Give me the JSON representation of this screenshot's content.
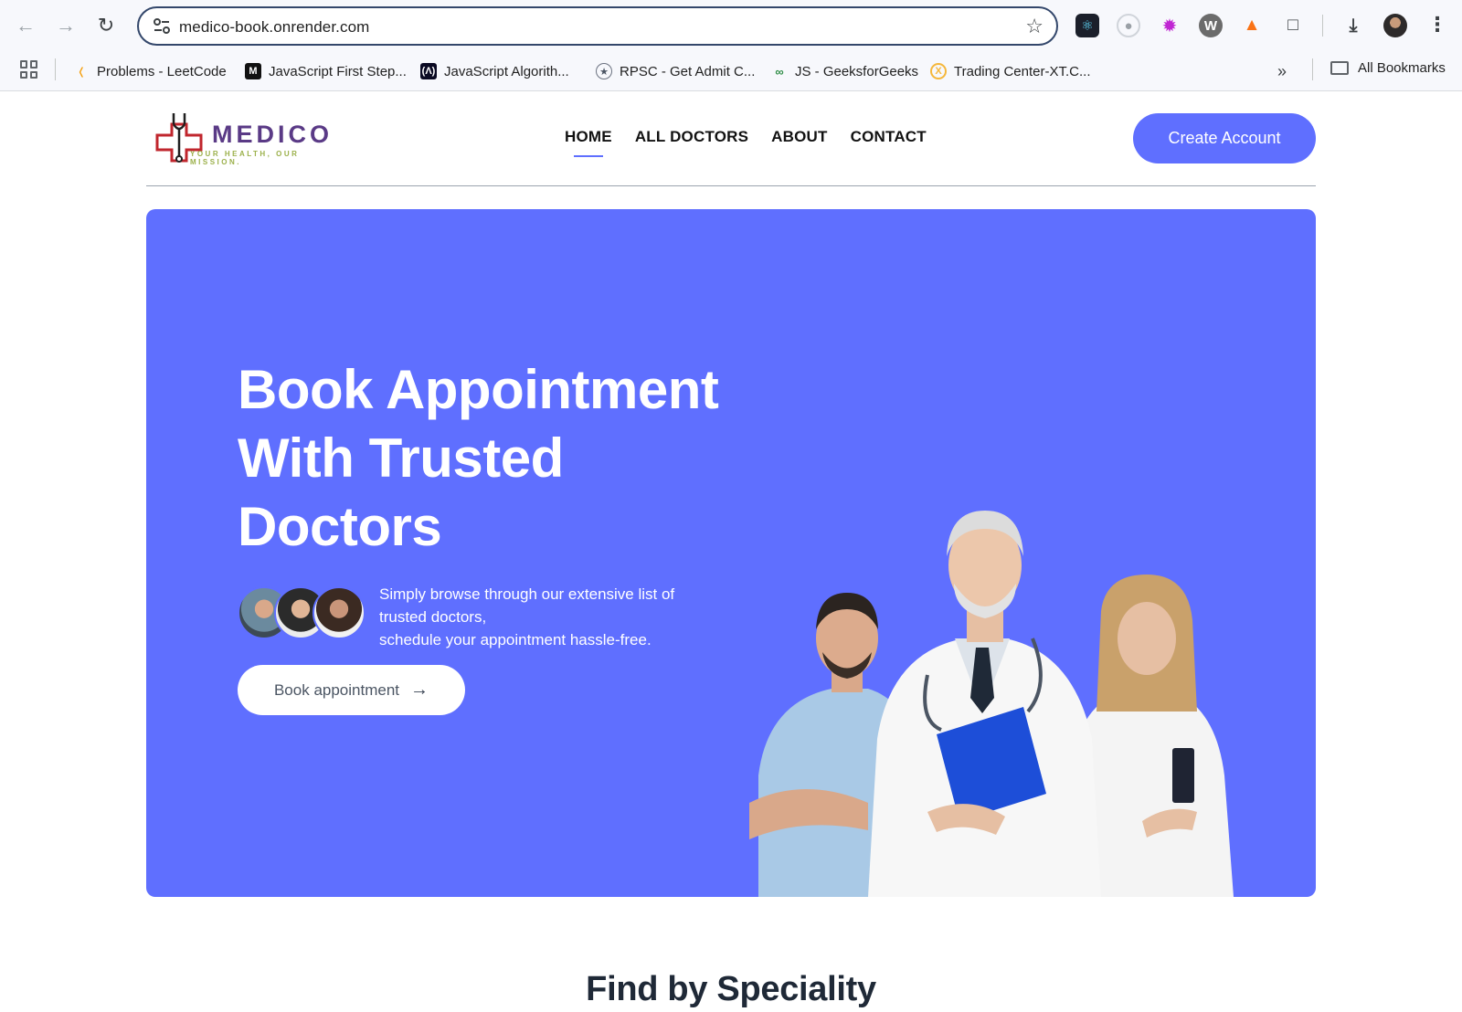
{
  "browser": {
    "url": "medico-book.onrender.com",
    "bookmarks": [
      {
        "label": "Problems - LeetCode",
        "icon": "leetcode-icon"
      },
      {
        "label": "JavaScript First Step...",
        "icon": "mdn-icon"
      },
      {
        "label": "JavaScript Algorith...",
        "icon": "freecodecamp-icon"
      },
      {
        "label": "RPSC - Get Admit C...",
        "icon": "rpsc-icon"
      },
      {
        "label": "JS - GeeksforGeeks",
        "icon": "geeksforgeeks-icon"
      },
      {
        "label": "Trading Center-XT.C...",
        "icon": "xt-icon"
      }
    ],
    "all_bookmarks_label": "All Bookmarks",
    "extensions": [
      "react-devtools-icon",
      "eye-dropper-icon",
      "colorful-swirl-icon",
      "wordpress-icon",
      "fox-extension-icon",
      "puzzle-extensions-icon"
    ]
  },
  "site": {
    "logo_word": "MEDICO",
    "logo_tagline": "YOUR HEALTH, OUR MISSION.",
    "nav": [
      {
        "label": "HOME",
        "active": true
      },
      {
        "label": "ALL DOCTORS",
        "active": false
      },
      {
        "label": "ABOUT",
        "active": false
      },
      {
        "label": "CONTACT",
        "active": false
      }
    ],
    "create_account_label": "Create Account",
    "accent_color": "#5f6fff"
  },
  "hero": {
    "title_lines": [
      "Book Appointment",
      "With Trusted",
      "Doctors"
    ],
    "subtitle_lines": [
      "Simply browse through our extensive list of",
      "trusted doctors,",
      "schedule your appointment hassle-free."
    ],
    "button_label": "Book appointment"
  },
  "speciality": {
    "title": "Find by Speciality"
  }
}
